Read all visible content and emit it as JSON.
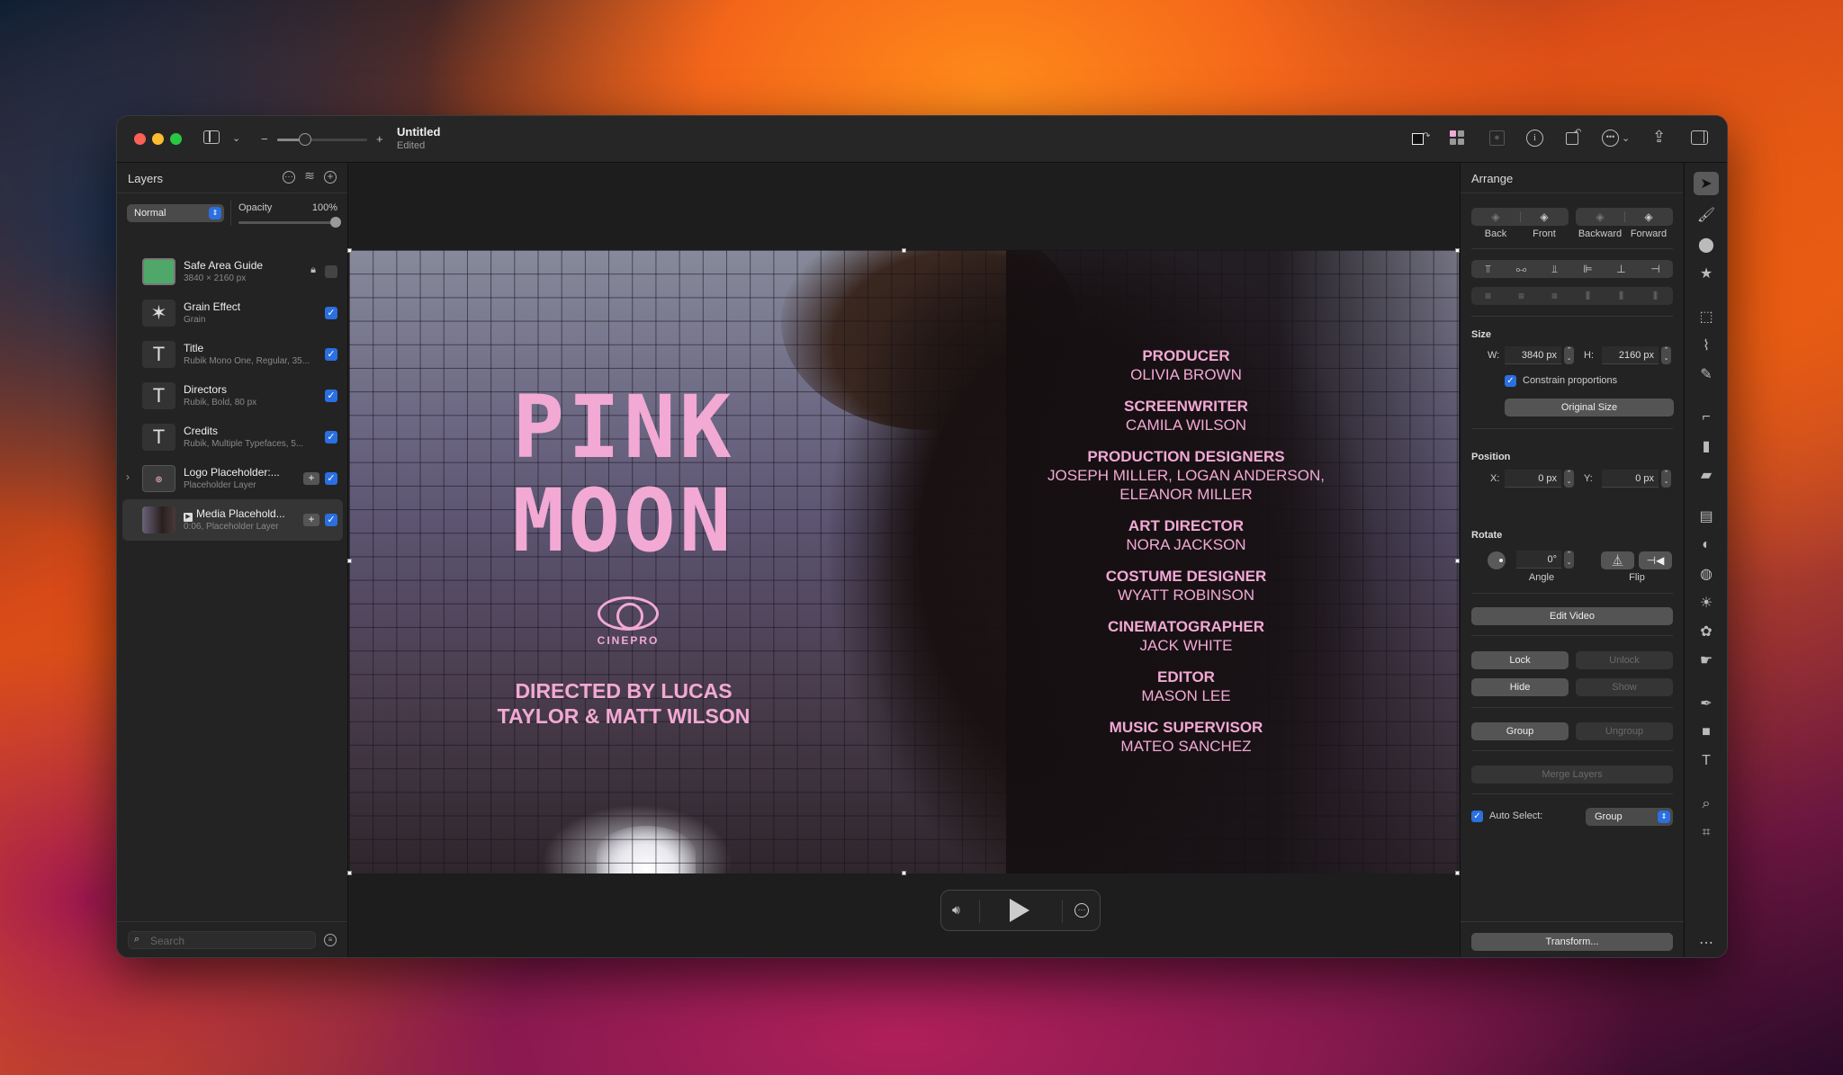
{
  "window": {
    "title": "Untitled",
    "subtitle": "Edited",
    "zoom_minus": "−",
    "zoom_plus": "+",
    "zoom_fraction": 0.3,
    "toolbar_icons": [
      "color-swap-icon",
      "photo-grid-icon",
      "portrait-icon",
      "info-icon",
      "rotate-icon",
      "more-icon",
      "share-icon",
      "sidebar-right-icon"
    ]
  },
  "layers_panel": {
    "title": "Layers",
    "blend_mode": "Normal",
    "opacity_label": "Opacity",
    "opacity_value": "100%",
    "opacity_fraction": 1.0,
    "layers": [
      {
        "name": "Safe Area Guide",
        "sub": "3840 × 2160 px",
        "visible": false,
        "locked": true,
        "thumb": "green-rect"
      },
      {
        "name": "Grain Effect",
        "sub": "Grain",
        "visible": true,
        "thumb": "star"
      },
      {
        "name": "Title",
        "sub": "Rubik Mono One, Regular, 35...",
        "visible": true,
        "thumb": "T"
      },
      {
        "name": "Directors",
        "sub": "Rubik, Bold, 80 px",
        "visible": true,
        "thumb": "T"
      },
      {
        "name": "Credits",
        "sub": "Rubik, Multiple Typefaces, 5...",
        "visible": true,
        "thumb": "T"
      },
      {
        "name": "Logo Placeholder:...",
        "sub": "Placeholder Layer",
        "visible": true,
        "thumb": "logo",
        "expandable": true,
        "addable": true
      },
      {
        "name": "Media Placehold...",
        "sub": "0:06, Placeholder Layer",
        "visible": true,
        "thumb": "video",
        "addable": true,
        "selected": true
      }
    ],
    "search_placeholder": "Search"
  },
  "canvas": {
    "title_line1": "PINK",
    "title_line2": "MOON",
    "logo_text": "CINEPRO",
    "directors_line1": "DIRECTED BY LUCAS",
    "directors_line2": "TAYLOR & MATT WILSON",
    "credits": [
      {
        "role": "PRODUCER",
        "names": [
          "OLIVIA BROWN"
        ]
      },
      {
        "role": "SCREENWRITER",
        "names": [
          "CAMILA WILSON"
        ]
      },
      {
        "role": "PRODUCTION DESIGNERS",
        "names": [
          "JOSEPH MILLER, LOGAN ANDERSON,",
          "ELEANOR MILLER"
        ]
      },
      {
        "role": "ART DIRECTOR",
        "names": [
          "NORA JACKSON"
        ]
      },
      {
        "role": "COSTUME DESIGNER",
        "names": [
          "WYATT ROBINSON"
        ]
      },
      {
        "role": "CINEMATOGRAPHER",
        "names": [
          "JACK WHITE"
        ]
      },
      {
        "role": "EDITOR",
        "names": [
          "MASON LEE"
        ]
      },
      {
        "role": "MUSIC SUPERVISOR",
        "names": [
          "MATEO SANCHEZ"
        ]
      }
    ],
    "accent_color": "#f2a9d4",
    "add_button": "+"
  },
  "arrange_panel": {
    "title": "Arrange",
    "order_labels": [
      "Back",
      "Front",
      "Backward",
      "Forward"
    ],
    "size_label": "Size",
    "w_label": "W:",
    "w_value": "3840 px",
    "h_label": "H:",
    "h_value": "2160 px",
    "constrain_label": "Constrain proportions",
    "constrain_checked": true,
    "original_size": "Original Size",
    "position_label": "Position",
    "x_label": "X:",
    "x_value": "0 px",
    "y_label": "Y:",
    "y_value": "0 px",
    "rotate_label": "Rotate",
    "angle_value": "0°",
    "angle_label": "Angle",
    "flip_label": "Flip",
    "edit_video": "Edit Video",
    "lock": "Lock",
    "unlock": "Unlock",
    "hide": "Hide",
    "show": "Show",
    "group": "Group",
    "ungroup": "Ungroup",
    "merge_layers": "Merge Layers",
    "auto_select_label": "Auto Select:",
    "auto_select_checked": true,
    "auto_select_value": "Group",
    "transform": "Transform..."
  },
  "tools": [
    "arrange",
    "paint-brush-style",
    "color-adjust",
    "effects-star",
    "rect-select",
    "lasso-select",
    "magic-select",
    "brush",
    "paint-bucket",
    "eraser",
    "clone",
    "retouch",
    "blur",
    "light",
    "color",
    "smudge",
    "pen",
    "shape",
    "text",
    "zoom",
    "crop",
    "more"
  ]
}
